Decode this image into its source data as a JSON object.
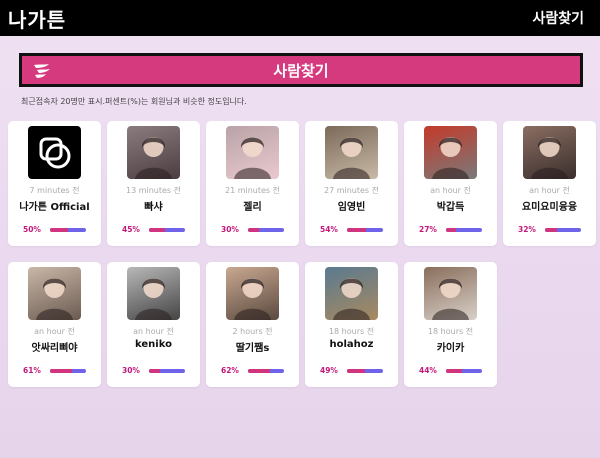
{
  "header": {
    "logo": "나가튼",
    "nav_label": "사람찾기"
  },
  "banner": {
    "title": "사람찾기",
    "icon": "wings-icon"
  },
  "notice": "최근접속자 20명만 표시.퍼센트(%)는 회원님과 비슷한 정도입니다.",
  "colors": {
    "banner": "#d63a7e",
    "percent_text": "#c2187a",
    "bar_fill": "#d1347e",
    "bar_track": "#6f63ea"
  },
  "people": [
    {
      "time": "7 minutes 전",
      "name": "나가튼 Official",
      "percent": "50%",
      "match": 50,
      "avatar": "logo"
    },
    {
      "time": "13 minutes 전",
      "name": "빠샤",
      "percent": "45%",
      "match": 45,
      "avatar": "photo"
    },
    {
      "time": "21 minutes 전",
      "name": "젤리",
      "percent": "30%",
      "match": 30,
      "avatar": "photo"
    },
    {
      "time": "27 minutes 전",
      "name": "임영빈",
      "percent": "54%",
      "match": 54,
      "avatar": "photo"
    },
    {
      "time": "an hour 전",
      "name": "박갑득",
      "percent": "27%",
      "match": 27,
      "avatar": "photo"
    },
    {
      "time": "an hour 전",
      "name": "요미요미융융",
      "percent": "32%",
      "match": 32,
      "avatar": "photo"
    },
    {
      "time": "an hour 전",
      "name": "앗싸리삐야",
      "percent": "61%",
      "match": 61,
      "avatar": "photo"
    },
    {
      "time": "an hour 전",
      "name": "keniko",
      "percent": "30%",
      "match": 30,
      "avatar": "photo"
    },
    {
      "time": "2 hours 전",
      "name": "딸기쨈s",
      "percent": "62%",
      "match": 62,
      "avatar": "photo"
    },
    {
      "time": "18 hours 전",
      "name": "holahoz",
      "percent": "49%",
      "match": 49,
      "avatar": "photo"
    },
    {
      "time": "18 hours 전",
      "name": "카이카",
      "percent": "44%",
      "match": 44,
      "avatar": "photo"
    }
  ]
}
